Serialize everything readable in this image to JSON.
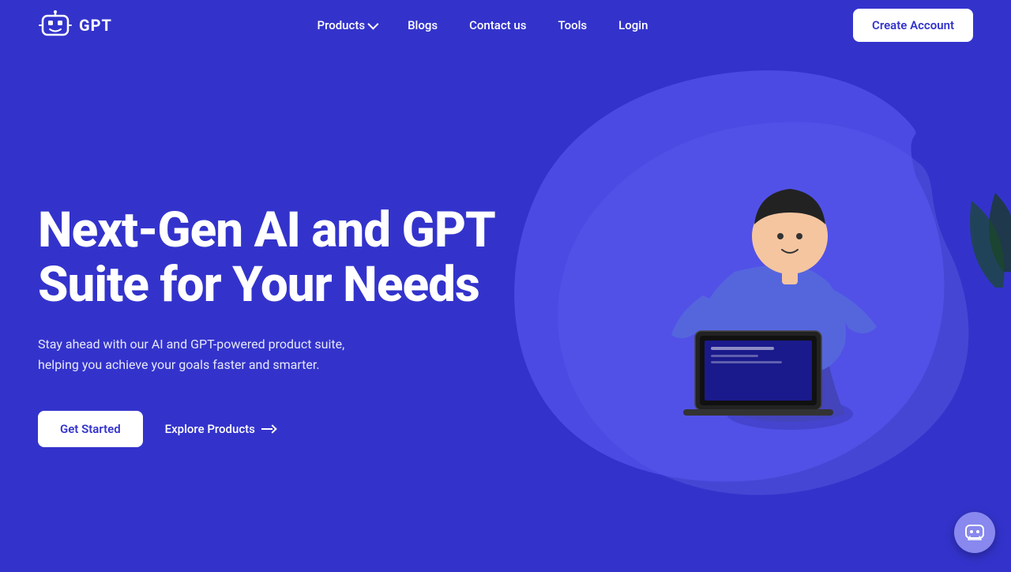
{
  "nav": {
    "logo_text": "GPT",
    "links": [
      {
        "label": "Products",
        "has_dropdown": true
      },
      {
        "label": "Blogs",
        "has_dropdown": false
      },
      {
        "label": "Contact us",
        "has_dropdown": false
      },
      {
        "label": "Tools",
        "has_dropdown": false
      },
      {
        "label": "Login",
        "has_dropdown": false
      }
    ],
    "cta_label": "Create Account"
  },
  "hero": {
    "title": "Next-Gen AI and GPT Suite for Your Needs",
    "subtitle": "Stay ahead with our AI and GPT-powered product suite, helping you achieve your goals faster and smarter.",
    "get_started_label": "Get Started",
    "explore_label": "Explore Products"
  },
  "colors": {
    "bg": "#3333cc",
    "white": "#ffffff",
    "blob": "#4444e0"
  }
}
